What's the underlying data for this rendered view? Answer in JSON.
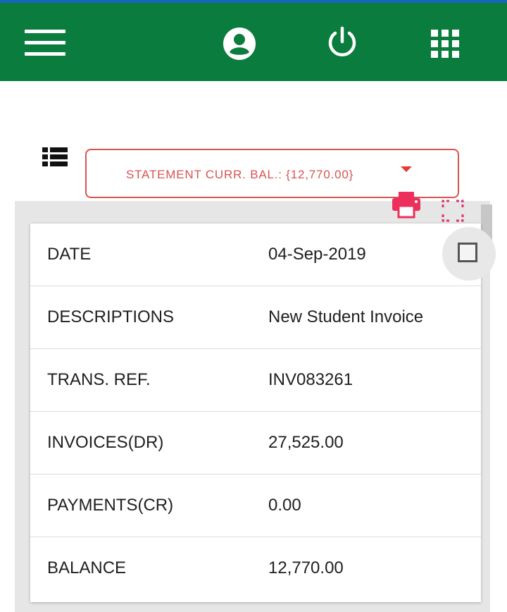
{
  "app_bar": {
    "background_color": "#0a7c3d",
    "icons": {
      "menu": "hamburger-menu-icon",
      "profile": "account-circle-icon",
      "logout": "power-icon",
      "apps": "apps-grid-icon"
    }
  },
  "statement": {
    "selector_label": "STATEMENT CURR. BAL.: {12,770.00}",
    "accent_color": "#d9534f"
  },
  "transaction": {
    "rows": [
      {
        "key": "DATE",
        "value": "04-Sep-2019"
      },
      {
        "key": "DESCRIPTIONS",
        "value": "New Student Invoice"
      },
      {
        "key": "TRANS. REF.",
        "value": "INV083261"
      },
      {
        "key": "INVOICES(DR)",
        "value": "27,525.00"
      },
      {
        "key": "PAYMENTS(CR)",
        "value": "0.00"
      },
      {
        "key": "BALANCE",
        "value": "12,770.00"
      }
    ]
  }
}
